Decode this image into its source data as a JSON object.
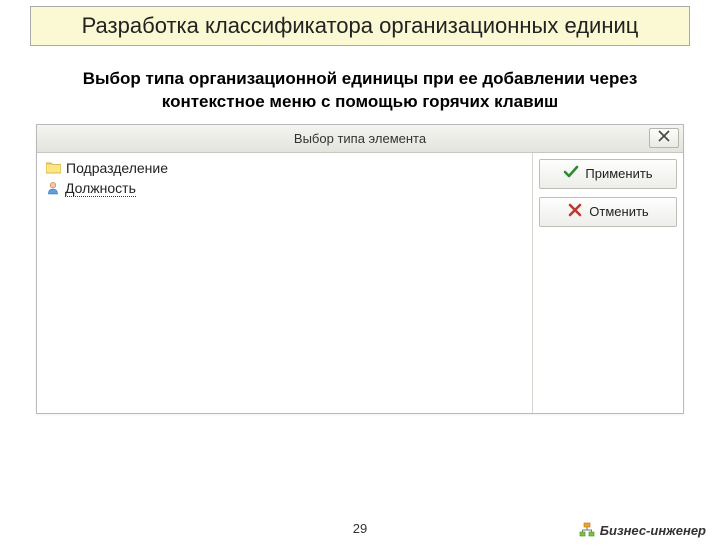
{
  "slide": {
    "title": "Разработка классификатора организационных единиц",
    "subtitle": "Выбор типа организационной единицы при ее добавлении через контекстное меню с помощью горячих клавиш",
    "page_number": "29",
    "brand": "Бизнес-инженер"
  },
  "dialog": {
    "title": "Выбор типа элемента",
    "items": [
      {
        "label": "Подразделение"
      },
      {
        "label": "Должность"
      }
    ],
    "apply": "Применить",
    "cancel": "Отменить"
  }
}
